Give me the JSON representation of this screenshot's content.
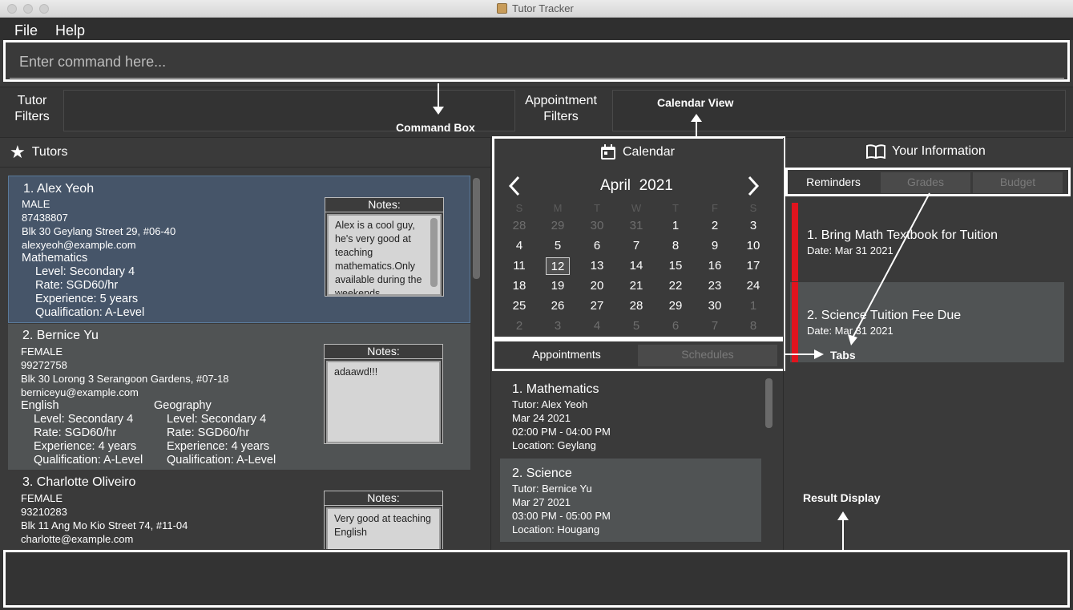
{
  "window": {
    "title": "Tutor Tracker"
  },
  "menu": {
    "file": "File",
    "help": "Help"
  },
  "command": {
    "placeholder": "Enter command here..."
  },
  "filters": {
    "tutor_label_1": "Tutor",
    "tutor_label_2": "Filters",
    "appt_label_1": "Appointment",
    "appt_label_2": "Filters"
  },
  "tutors_panel": {
    "title": "Tutors",
    "cards": [
      {
        "name": "1.  Alex Yeoh",
        "gender": "MALE",
        "phone": "87438807",
        "address": "Blk 30 Geylang Street 29, #06-40",
        "email": "alexyeoh@example.com",
        "subjects": [
          {
            "name": "Mathematics",
            "level": "Level: Secondary 4",
            "rate": "Rate: SGD60/hr",
            "experience": "Experience: 5 years",
            "qualification": "Qualification: A-Level"
          }
        ],
        "notes_title": "Notes:",
        "notes": "Alex is a cool guy, he's very good at teaching mathematics.Only available during the weekends."
      },
      {
        "name": "2.  Bernice Yu",
        "gender": "FEMALE",
        "phone": "99272758",
        "address": "Blk 30 Lorong 3 Serangoon Gardens, #07-18",
        "email": "berniceyu@example.com",
        "subjects": [
          {
            "name": "English",
            "level": "Level: Secondary 4",
            "rate": "Rate: SGD60/hr",
            "experience": "Experience: 4 years",
            "qualification": "Qualification: A-Level"
          },
          {
            "name": "Geography",
            "level": "Level: Secondary 4",
            "rate": "Rate: SGD60/hr",
            "experience": "Experience: 4 years",
            "qualification": "Qualification: A-Level"
          }
        ],
        "notes_title": "Notes:",
        "notes": "adaawd!!!"
      },
      {
        "name": "3.  Charlotte Oliveiro",
        "gender": "FEMALE",
        "phone": "93210283",
        "address": "Blk 11 Ang Mo Kio Street 74, #11-04",
        "email": "charlotte@example.com",
        "notes_title": "Notes:",
        "notes": "Very good at teaching English"
      }
    ]
  },
  "calendar": {
    "title": "Calendar",
    "month": "April",
    "year": "2021",
    "day_headers": [
      "S",
      "M",
      "T",
      "W",
      "T",
      "F",
      "S"
    ],
    "weeks": [
      [
        "28",
        "29",
        "30",
        "31",
        "1",
        "2",
        "3"
      ],
      [
        "4",
        "5",
        "6",
        "7",
        "8",
        "9",
        "10"
      ],
      [
        "11",
        "12",
        "13",
        "14",
        "15",
        "16",
        "17"
      ],
      [
        "18",
        "19",
        "20",
        "21",
        "22",
        "23",
        "24"
      ],
      [
        "25",
        "26",
        "27",
        "28",
        "29",
        "30",
        "1"
      ],
      [
        "2",
        "3",
        "4",
        "5",
        "6",
        "7",
        "8"
      ]
    ],
    "selected_day": "12"
  },
  "appointment_tabs": {
    "appointments": "Appointments",
    "schedules": "Schedules"
  },
  "appointments": [
    {
      "title": "1.  Mathematics",
      "tutor": "Tutor: Alex Yeoh",
      "date": "Mar 24 2021",
      "time": "02:00 PM - 04:00 PM",
      "location": "Location: Geylang"
    },
    {
      "title": "2.  Science",
      "tutor": "Tutor: Bernice Yu",
      "date": "Mar 27 2021",
      "time": "03:00 PM - 05:00 PM",
      "location": "Location: Hougang"
    }
  ],
  "info_panel": {
    "title": "Your Information",
    "tabs": {
      "reminders": "Reminders",
      "grades": "Grades",
      "budget": "Budget"
    },
    "reminders": [
      {
        "title": "1.  Bring Math Textbook for Tuition",
        "date": "Date:  Mar 31 2021"
      },
      {
        "title": "2.  Science Tuition Fee Due",
        "date": "Date:  Mar 31 2021"
      }
    ]
  },
  "annotations": {
    "command_box": "Command Box",
    "calendar_view": "Calendar View",
    "tabs": "Tabs",
    "result_display": "Result Display"
  },
  "colors": {
    "reminder_accent": "#e0141e",
    "selected_card": "#465569",
    "background": "#3a3a3a"
  }
}
